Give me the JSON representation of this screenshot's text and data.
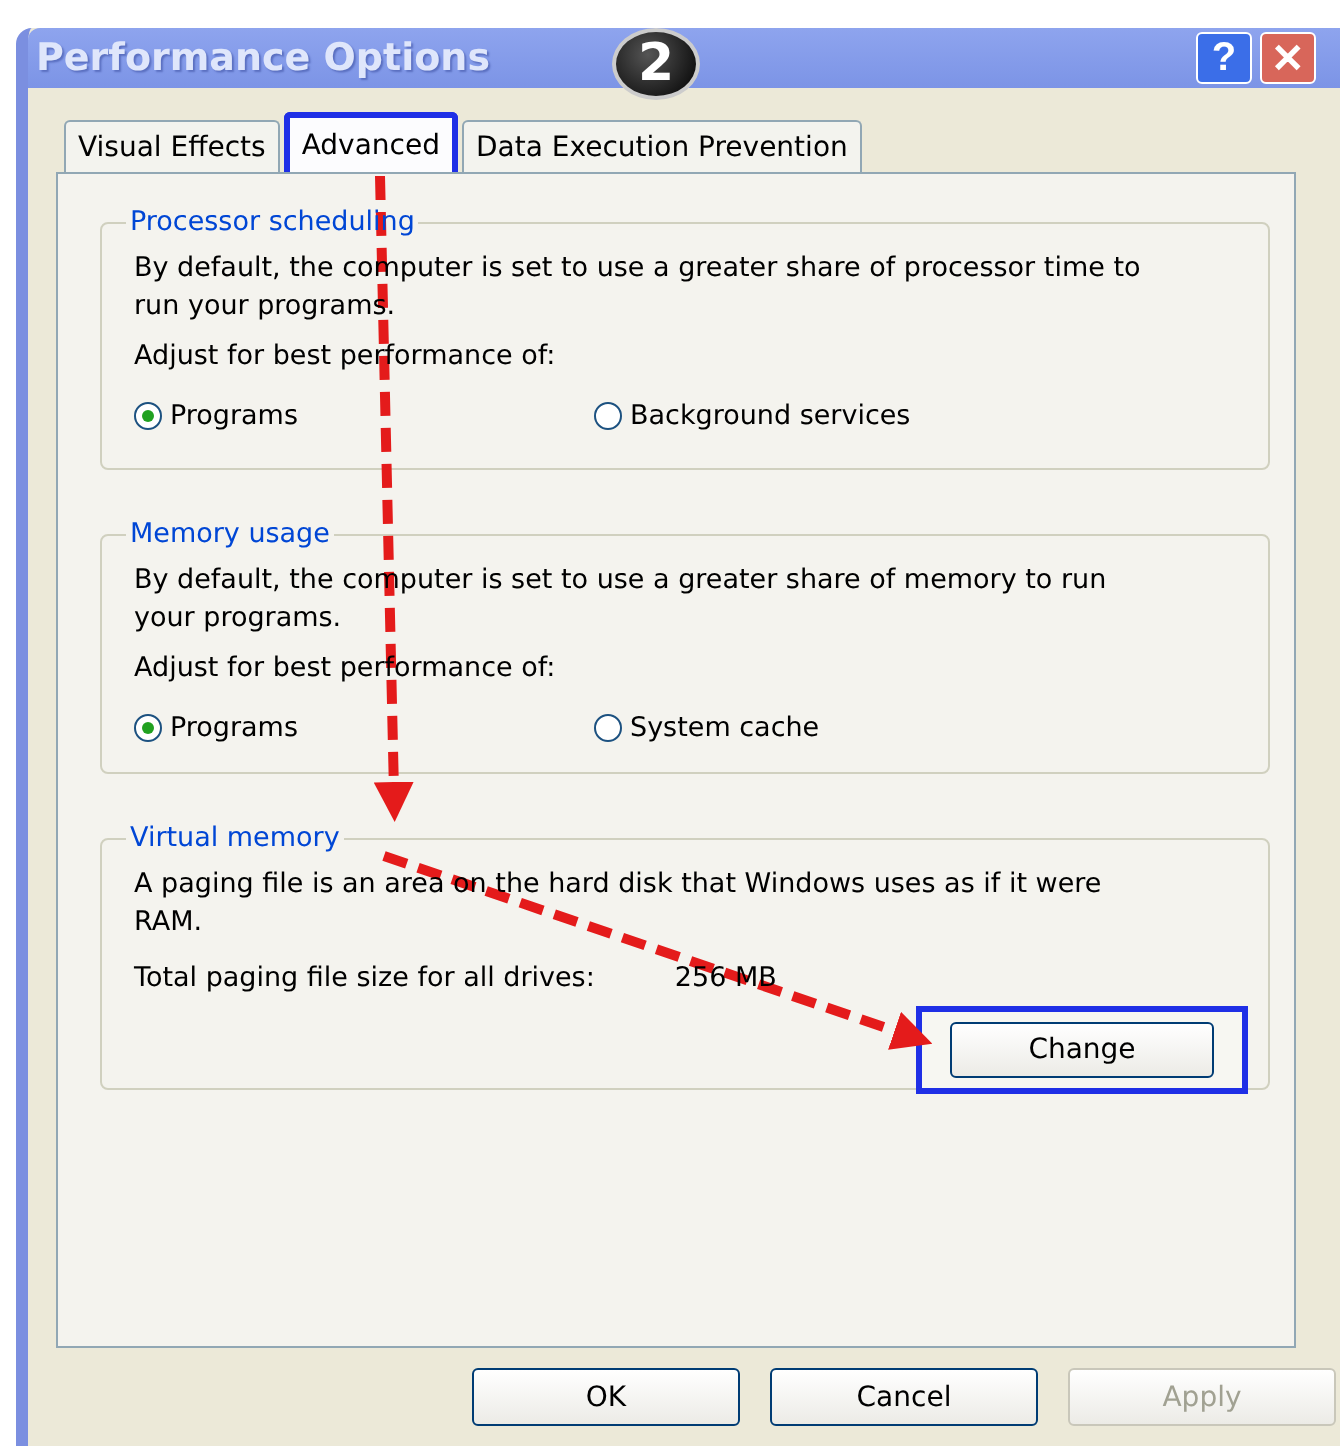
{
  "window": {
    "title": "Performance Options",
    "step_badge": "2",
    "title_buttons": [
      "?",
      "✕"
    ]
  },
  "tabs": [
    {
      "label": "Visual Effects",
      "selected": false,
      "highlighted": false
    },
    {
      "label": "Advanced",
      "selected": true,
      "highlighted": true
    },
    {
      "label": "Data Execution Prevention",
      "selected": false,
      "highlighted": false
    }
  ],
  "processor_scheduling": {
    "legend": "Processor scheduling",
    "description": "By default, the computer is set to use a greater share of processor time to run your programs.",
    "prompt": "Adjust for best performance of:",
    "options": [
      {
        "label": "Programs",
        "selected": true
      },
      {
        "label": "Background services",
        "selected": false
      }
    ]
  },
  "memory_usage": {
    "legend": "Memory usage",
    "description": "By default, the computer is set to use a greater share of memory to run your programs.",
    "prompt": "Adjust for best performance of:",
    "options": [
      {
        "label": "Programs",
        "selected": true
      },
      {
        "label": "System cache",
        "selected": false
      }
    ]
  },
  "virtual_memory": {
    "legend": "Virtual memory",
    "description": "A paging file is an area on the hard disk that Windows uses as if it were RAM.",
    "total_label": "Total paging file size for all drives:",
    "total_value": "256 MB",
    "button": {
      "label": "Change",
      "highlighted": true
    }
  },
  "buttons": [
    {
      "label": "OK",
      "disabled": false
    },
    {
      "label": "Cancel",
      "disabled": false
    },
    {
      "label": "Apply",
      "disabled": true
    }
  ]
}
